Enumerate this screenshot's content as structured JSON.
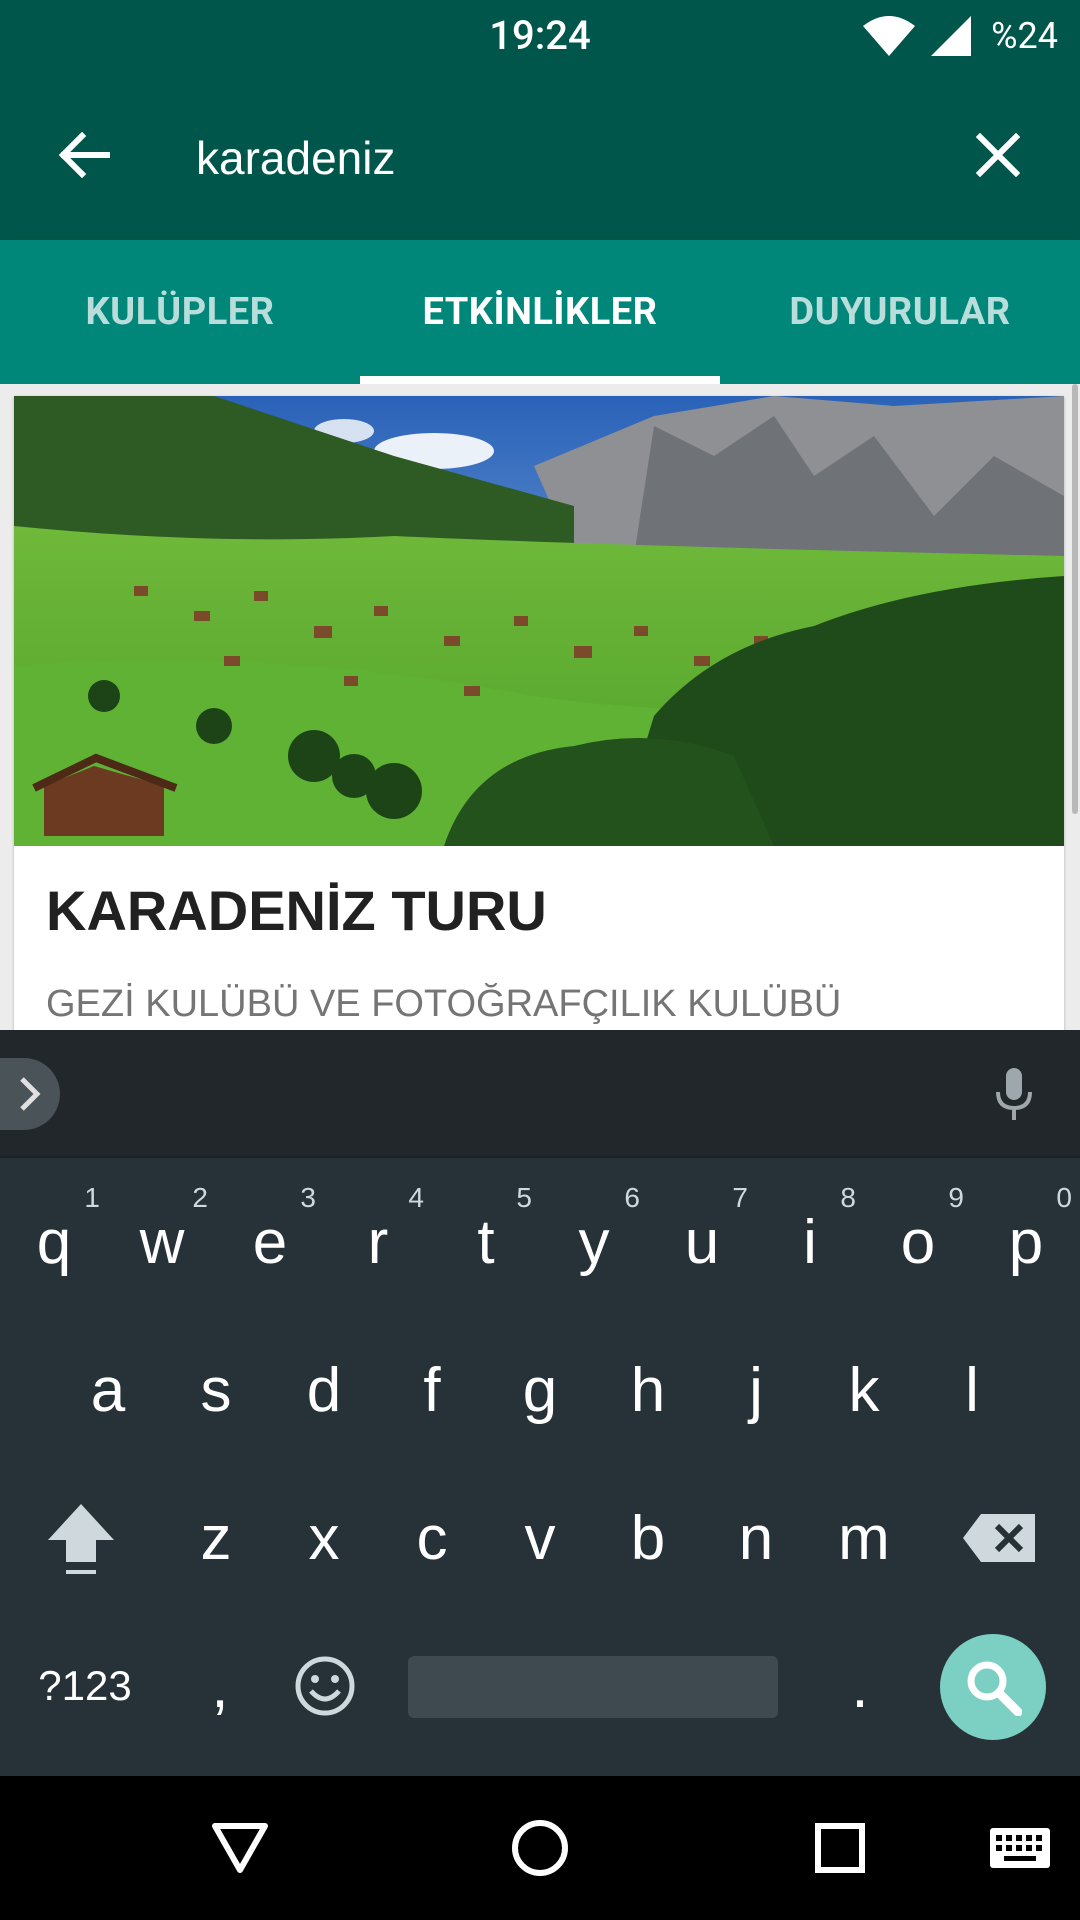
{
  "status_bar": {
    "time": "19:24",
    "battery": "%24"
  },
  "search": {
    "query": "karadeniz"
  },
  "tabs": [
    {
      "label": "KULÜPLER",
      "active": false
    },
    {
      "label": "ETKİNLİKLER",
      "active": true
    },
    {
      "label": "DUYURULAR",
      "active": false
    }
  ],
  "event_card": {
    "title": "KARADENİZ TURU",
    "subtitle": "GEZİ KULÜBÜ VE FOTOĞRAFÇILIK KULÜBÜ"
  },
  "keyboard": {
    "row1": [
      "q",
      "w",
      "e",
      "r",
      "t",
      "y",
      "u",
      "i",
      "o",
      "p"
    ],
    "row1_hints": [
      "1",
      "2",
      "3",
      "4",
      "5",
      "6",
      "7",
      "8",
      "9",
      "0"
    ],
    "row2": [
      "a",
      "s",
      "d",
      "f",
      "g",
      "h",
      "j",
      "k",
      "l"
    ],
    "row3": [
      "z",
      "x",
      "c",
      "v",
      "b",
      "n",
      "m"
    ],
    "symbols_label": "?123",
    "comma": ",",
    "period": "."
  },
  "colors": {
    "primary_dark": "#00564a",
    "primary": "#00877a",
    "keyboard_bg": "#263238",
    "search_fab": "#7ccfc3"
  }
}
